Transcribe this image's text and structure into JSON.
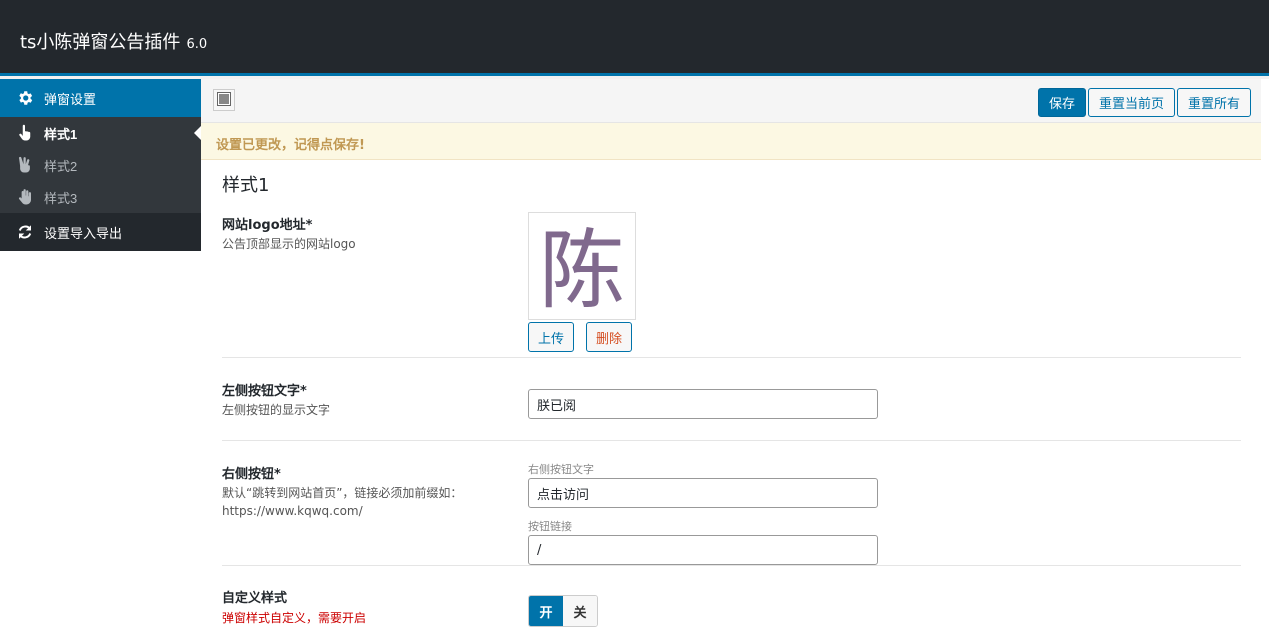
{
  "app": {
    "title": "ts小陈弹窗公告插件",
    "version": "6.0"
  },
  "sidebar": {
    "items": [
      {
        "label": "弹窗设置",
        "icon": "gear-icon"
      },
      {
        "label": "样式1",
        "icon": "hand-pointer-icon"
      },
      {
        "label": "样式2",
        "icon": "hand-peace-icon"
      },
      {
        "label": "样式3",
        "icon": "hand-paper-icon"
      },
      {
        "label": "设置导入导出",
        "icon": "refresh-icon"
      }
    ]
  },
  "toolbar": {
    "save": "保存",
    "reset_page": "重置当前页",
    "reset_all": "重置所有"
  },
  "notice": "设置已更改，记得点保存!",
  "section_title": "样式1",
  "fields": {
    "logo": {
      "label": "网站logo地址*",
      "desc": "公告顶部显示的网站logo",
      "upload": "上传",
      "delete": "删除",
      "logo_text": "陈"
    },
    "left_button": {
      "label": "左侧按钮文字*",
      "desc": "左侧按钮的显示文字",
      "value": "朕已阅"
    },
    "right_button": {
      "label": "右侧按钮*",
      "desc": "默认“跳转到网站首页”，链接必须加前缀如：",
      "desc_url": "https://www.kqwq.com/",
      "text_label": "右侧按钮文字",
      "text_value": "点击访问",
      "link_label": "按钮链接",
      "link_value": "/"
    },
    "custom_style": {
      "label": "自定义样式",
      "desc": "弹窗样式自定义，需要开启",
      "on": "开",
      "off": "关"
    }
  },
  "colors": {
    "accent": "#0073aa",
    "header": "#23282d",
    "notice_bg": "#fcf8e3",
    "notice_text": "#c09853",
    "danger": "#cc0000"
  }
}
